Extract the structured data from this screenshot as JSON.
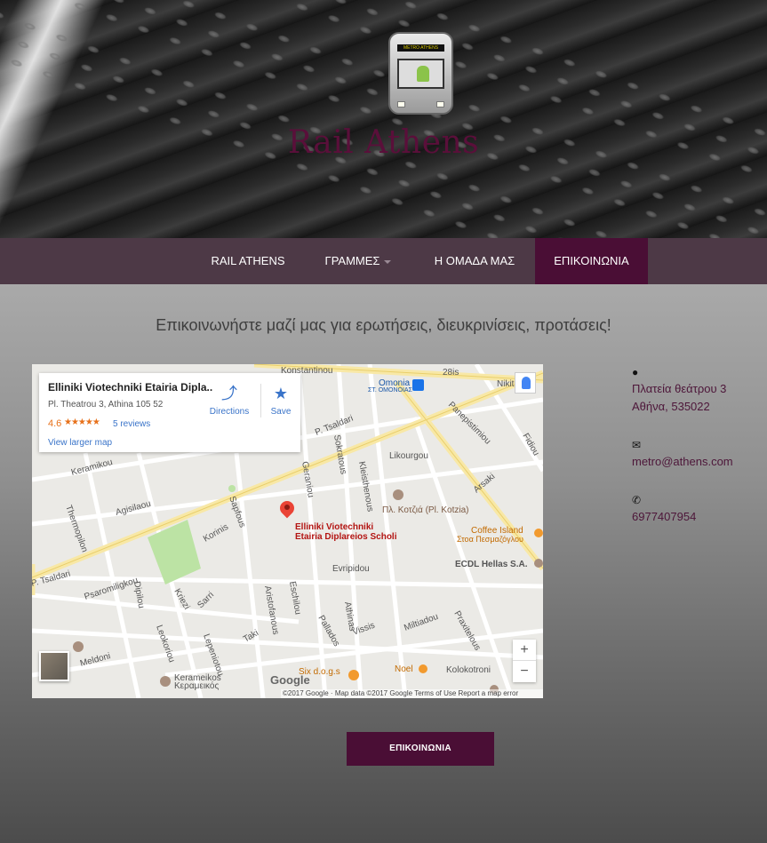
{
  "header": {
    "brand_title": "Rail Athens",
    "logo_text": "METRO ATHENS"
  },
  "nav": {
    "items": [
      {
        "label": "RAIL ATHENS",
        "active": false,
        "dropdown": false
      },
      {
        "label": "ΓΡΑΜΜΕΣ",
        "active": false,
        "dropdown": true
      },
      {
        "label": "Η ΟΜΑΔΑ ΜΑΣ",
        "active": false,
        "dropdown": false
      },
      {
        "label": "ΕΠΙΚΟΙΝΩΝΙΑ",
        "active": true,
        "dropdown": false
      }
    ]
  },
  "main": {
    "tagline": "Επικοινωνήστε μαζί μας για ερωτήσεις, διευκρινίσεις, προτάσεις!",
    "cta_label": "ΕΠΙΚΟΙΝΩΝΙΑ"
  },
  "map": {
    "place_name": "Elliniki Viotechniki Etairia Dipla..",
    "place_address": "Pl. Theatrou 3, Athina 105 52",
    "rating": "4.6",
    "stars": "★★★★★",
    "reviews": "5 reviews",
    "view_larger": "View larger map",
    "directions": "Directions",
    "save": "Save",
    "zoom_in": "+",
    "zoom_out": "−",
    "google_logo": "Google",
    "attribution": "©2017 Google · Map data ©2017 Google   Terms of Use   Report a map error",
    "pin_label_line1": "Elliniki Viotechniki",
    "pin_label_line2": "Etairia Diplareios Scholi",
    "labels": [
      "Konstantinou",
      "Omonia",
      "ΣΤ. ΟΜΟΝΟΙΑΣ",
      "28is",
      "Nikitara",
      "Panepistimiou",
      "P. Tsaldari",
      "Likourgou",
      "Sokratous",
      "Geraniou",
      "Keramikou",
      "Agisilaou",
      "Thermopilon",
      "Kleisthenous",
      "Arsaki",
      "Fidiou",
      "Πλ. Κοτζιά (Pl. Kotzia)",
      "Coffee Island",
      "Στοα Πεσμαζόγλου",
      "ECDL Hellas S.A.",
      "Evripidou",
      "Aristofanous",
      "Eschilou",
      "Psaromiligkou",
      "Korinis",
      "Sapfous",
      "Dipilou",
      "Kriezi",
      "Sarri",
      "Leokoriou",
      "Lepeniotou",
      "Taki",
      "Pallados",
      "Athinas",
      "Vissis",
      "Miltiadou",
      "Praxitelous",
      "Kolokotroni",
      "Noel",
      "Six d.o.g.s",
      "Κεραμεικός",
      "Kerameikos",
      "Meldoni",
      "P. Tsaldari"
    ]
  },
  "contact": {
    "address_icon": "map-marker-icon",
    "address_line1": "Πλατεία θεάτρου 3",
    "address_line2": "Αθήνα, 535022",
    "email_icon": "envelope-icon",
    "email": "metro@athens.com",
    "phone_icon": "phone-icon",
    "phone": "6977407954"
  },
  "colors": {
    "nav_bg": "#4d3946",
    "active_bg": "#4a0e35",
    "brand_text": "#5a0f3a",
    "contact_text": "#4d1639"
  }
}
